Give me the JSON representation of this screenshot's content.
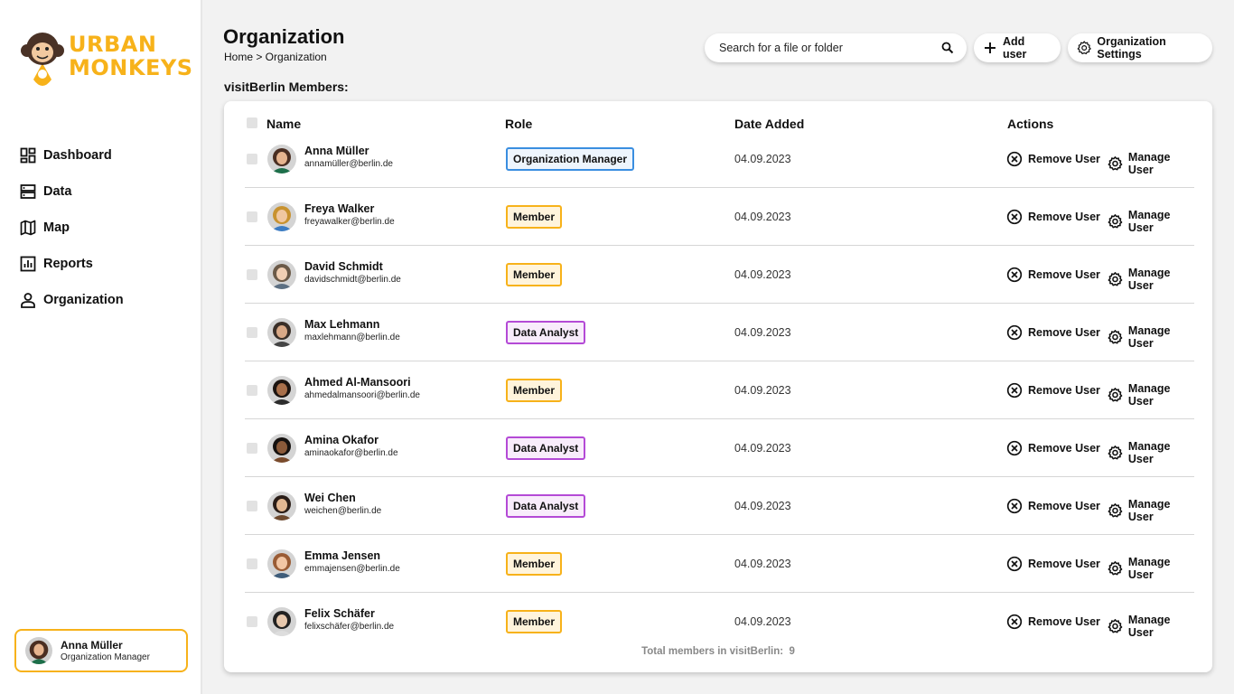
{
  "brand": {
    "line1": "URBAN",
    "line2": "MONKEYS",
    "color": "#f7b21a"
  },
  "nav": [
    {
      "label": "Dashboard",
      "icon": "dashboard-icon"
    },
    {
      "label": "Data",
      "icon": "data-icon"
    },
    {
      "label": "Map",
      "icon": "map-icon"
    },
    {
      "label": "Reports",
      "icon": "reports-icon"
    },
    {
      "label": "Organization",
      "icon": "person-icon"
    }
  ],
  "current_user": {
    "name": "Anna Müller",
    "role": "Organization Manager"
  },
  "header": {
    "title": "Organization",
    "breadcrumb": "Home > Organization",
    "search_placeholder": "Search for a file or folder",
    "add_user": "Add user",
    "org_settings": "Organization Settings"
  },
  "section_title": "visitBerlin Members:",
  "table": {
    "headers": {
      "name": "Name",
      "role": "Role",
      "date": "Date Added",
      "actions": "Actions"
    },
    "remove_label": "Remove User",
    "manage_label": "Manage User",
    "rows": [
      {
        "name": "Anna Müller",
        "email": "annamüller@berlin.de",
        "role": "Organization Manager",
        "role_type": "manager",
        "date": "04.09.2023"
      },
      {
        "name": "Freya Walker",
        "email": "freyawalker@berlin.de",
        "role": "Member",
        "role_type": "member",
        "date": "04.09.2023"
      },
      {
        "name": "David Schmidt",
        "email": "davidschmidt@berlin.de",
        "role": "Member",
        "role_type": "member",
        "date": "04.09.2023"
      },
      {
        "name": "Max Lehmann",
        "email": "maxlehmann@berlin.de",
        "role": "Data Analyst",
        "role_type": "analyst",
        "date": "04.09.2023"
      },
      {
        "name": "Ahmed Al-Mansoori",
        "email": "ahmedalmansoori@berlin.de",
        "role": "Member",
        "role_type": "member",
        "date": "04.09.2023"
      },
      {
        "name": "Amina Okafor",
        "email": "aminaokafor@berlin.de",
        "role": "Data Analyst",
        "role_type": "analyst",
        "date": "04.09.2023"
      },
      {
        "name": "Wei Chen",
        "email": "weichen@berlin.de",
        "role": "Data Analyst",
        "role_type": "analyst",
        "date": "04.09.2023"
      },
      {
        "name": "Emma Jensen",
        "email": "emmajensen@berlin.de",
        "role": "Member",
        "role_type": "member",
        "date": "04.09.2023"
      },
      {
        "name": "Felix Schäfer",
        "email": "felixschäfer@berlin.de",
        "role": "Member",
        "role_type": "member",
        "date": "04.09.2023"
      }
    ]
  },
  "footer": {
    "label": "Total members in visitBerlin:",
    "count": "9"
  }
}
